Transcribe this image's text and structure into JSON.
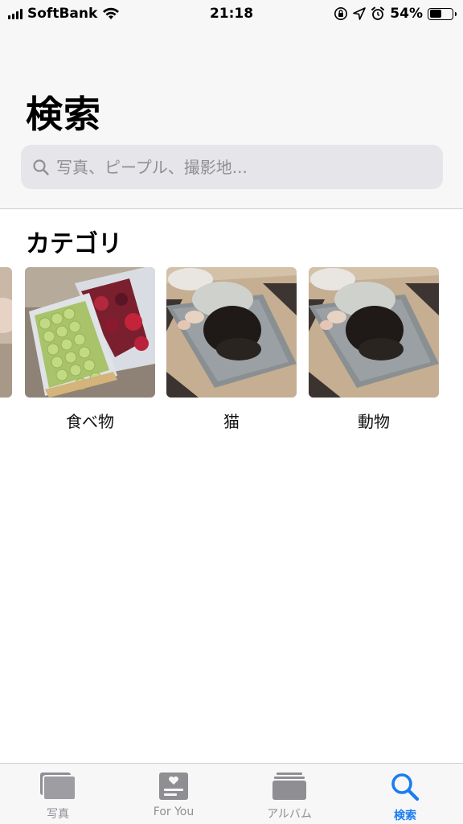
{
  "status_bar": {
    "carrier": "SoftBank",
    "time": "21:18",
    "battery_percent": "54%",
    "battery_level": 0.54,
    "icons": [
      "signal-icon",
      "wifi-icon",
      "orientation-lock-icon",
      "location-icon",
      "alarm-icon",
      "battery-icon"
    ]
  },
  "header": {
    "title": "検索"
  },
  "search": {
    "placeholder": "写真、ピープル、撮影地..."
  },
  "categories": {
    "title": "カテゴリ",
    "items": [
      {
        "label": ""
      },
      {
        "label": "食べ物"
      },
      {
        "label": "猫"
      },
      {
        "label": "動物"
      }
    ]
  },
  "tab_bar": {
    "tabs": [
      {
        "label": "写真",
        "icon": "photos-icon",
        "active": false
      },
      {
        "label": "For You",
        "icon": "for-you-icon",
        "active": false
      },
      {
        "label": "アルバム",
        "icon": "albums-icon",
        "active": false
      },
      {
        "label": "検索",
        "icon": "search-icon",
        "active": true
      }
    ],
    "active_color": "#1a7cf2",
    "inactive_color": "#8e8e93"
  }
}
